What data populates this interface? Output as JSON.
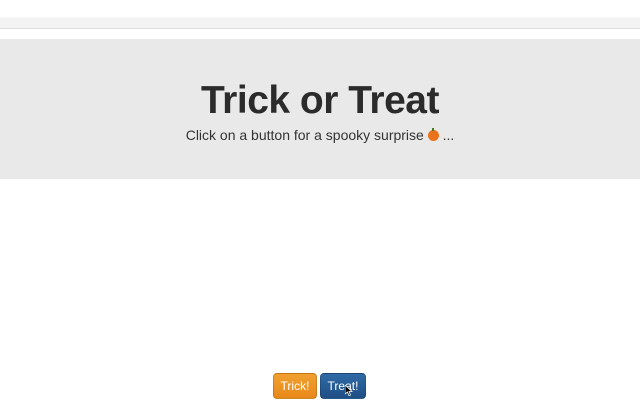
{
  "hero": {
    "title": "Trick or Treat",
    "subtitle": "Click on a button for a spooky surprise",
    "subtitle_suffix": "...",
    "emoji_icon": "jack-o-lantern"
  },
  "buttons": {
    "trick_label": "Trick!",
    "treat_label": "Treat!"
  },
  "colors": {
    "trick": "#e8891a",
    "treat": "#1f4f85",
    "jumbotron": "#e9e9e9"
  }
}
